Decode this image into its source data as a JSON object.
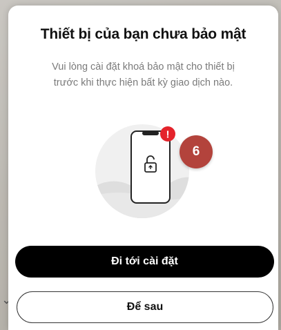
{
  "dialog": {
    "title": "Thiết bị của bạn chưa bảo mật",
    "message_line1": "Vui lòng cài đặt khoá bảo mật cho thiết bị",
    "message_line2": "trước khi thực hiện bất kỳ giao dịch nào."
  },
  "illustration": {
    "icon": "phone-unlocked-warning-icon",
    "alert_glyph": "!",
    "step_badge": "6"
  },
  "actions": {
    "primary_label": "Đi tới cài đặt",
    "secondary_label": "Để sau"
  },
  "colors": {
    "accent_alert": "#e4232b",
    "step_badge": "#b3433c",
    "primary_button": "#000000"
  }
}
